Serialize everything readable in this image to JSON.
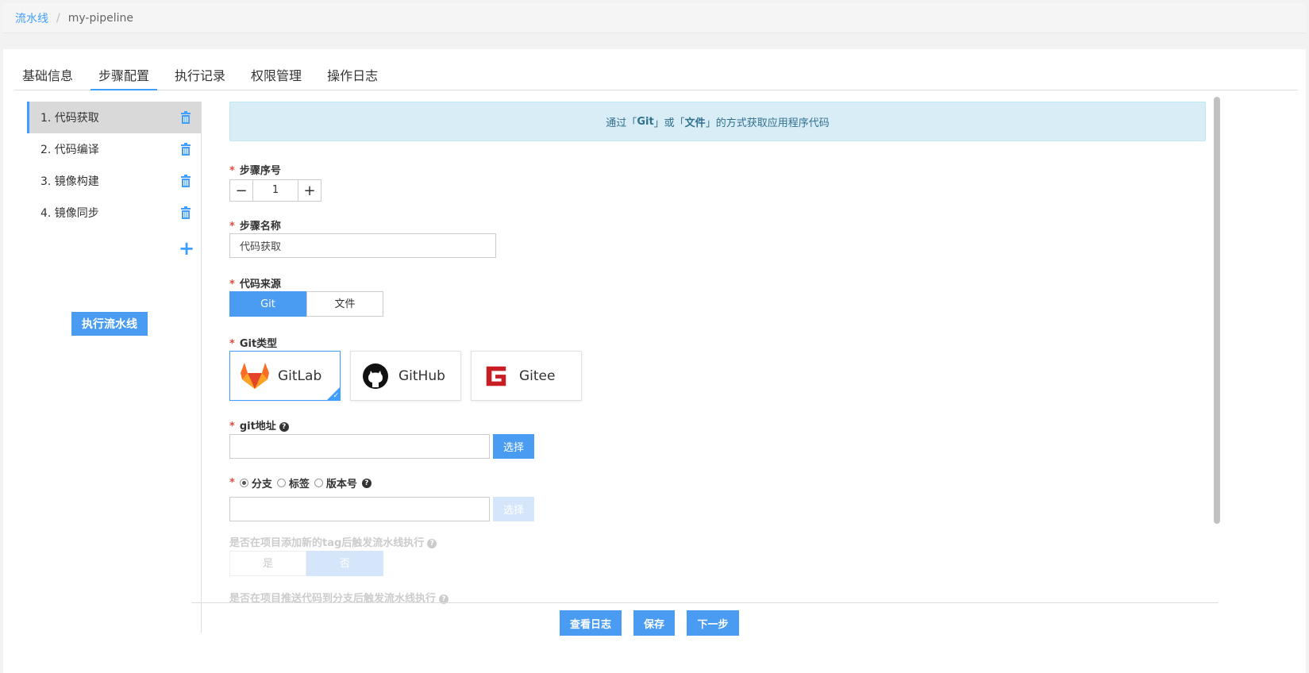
{
  "breadcrumb": {
    "root": "流水线",
    "separator": "/",
    "current": "my-pipeline"
  },
  "tabs": [
    {
      "label": "基础信息",
      "active": false
    },
    {
      "label": "步骤配置",
      "active": true
    },
    {
      "label": "执行记录",
      "active": false
    },
    {
      "label": "权限管理",
      "active": false
    },
    {
      "label": "操作日志",
      "active": false
    }
  ],
  "sidebar": {
    "steps": [
      {
        "label": "1. 代码获取",
        "active": true
      },
      {
        "label": "2. 代码编译",
        "active": false
      },
      {
        "label": "3. 镜像构建",
        "active": false
      },
      {
        "label": "4. 镜像同步",
        "active": false
      }
    ],
    "add_icon": "plus-icon",
    "run_button": "执行流水线"
  },
  "info": {
    "prefix": "通过「",
    "git": "Git",
    "mid1": "」或「",
    "file": "文件",
    "suffix": "」的方式获取应用程序代码"
  },
  "form": {
    "required_mark": "*",
    "step_no_label": "步骤序号",
    "step_no_value": "1",
    "step_name_label": "步骤名称",
    "step_name_value": "代码获取",
    "source_label": "代码来源",
    "source_options": [
      "Git",
      "文件"
    ],
    "source_selected": "Git",
    "git_type_label": "Git类型",
    "git_types": [
      "GitLab",
      "GitHub",
      "Gitee"
    ],
    "git_type_selected": "GitLab",
    "git_url_label": "git地址",
    "git_url_value": "",
    "select_label": "选择",
    "ref_options": [
      "分支",
      "标签",
      "版本号"
    ],
    "ref_selected": "分支",
    "ref_value": "",
    "tag_trigger_label": "是否在项目添加新的tag后触发流水线执行",
    "tag_trigger_options": [
      "是",
      "否"
    ],
    "tag_trigger_selected": "否",
    "push_trigger_label": "是否在项目推送代码到分支后触发流水线执行",
    "help_glyph": "?"
  },
  "footer": {
    "view_log": "查看日志",
    "save": "保存",
    "next": "下一步"
  },
  "colors": {
    "accent": "#409eff",
    "button": "#4a9cf3",
    "required": "#e74c3c",
    "info_bg": "#d9edf7"
  }
}
